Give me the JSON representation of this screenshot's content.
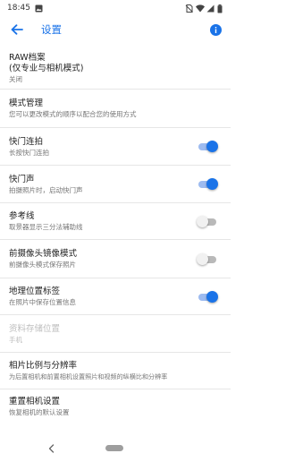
{
  "status_bar": {
    "time": "18:45",
    "icons": [
      "image-icon",
      "no-sim-icon",
      "wifi-icon",
      "signal-icon",
      "battery-icon"
    ]
  },
  "app_bar": {
    "title": "设置",
    "back_icon": "arrow-back-icon",
    "info_icon": "info-icon"
  },
  "settings": {
    "raw": {
      "title": "RAW档案",
      "title_line2": "(仅专业与相机模式)",
      "subtitle": "关闭"
    },
    "mode_management": {
      "title": "模式管理",
      "subtitle": "您可以更改模式的顺序以配合您的使用方式"
    },
    "burst": {
      "title": "快门连拍",
      "subtitle": "长按快门连拍",
      "enabled": true
    },
    "shutter_sound": {
      "title": "快门声",
      "subtitle": "拍摄照片时，启动快门声",
      "enabled": true
    },
    "grid": {
      "title": "参考线",
      "subtitle": "取景器显示三分法辅助线",
      "enabled": false
    },
    "front_mirror": {
      "title": "前摄像头镜像模式",
      "subtitle": "前摄像头模式保存照片",
      "enabled": false
    },
    "geo_tag": {
      "title": "地理位置标签",
      "subtitle": "在照片中保存位置信息",
      "enabled": true
    },
    "storage": {
      "title": "资料存储位置",
      "subtitle": "手机",
      "disabled": true
    },
    "aspect_ratio": {
      "title": "相片比例与分辨率",
      "subtitle": "为后置相机和前置相机设置照片和视频的纵横比和分辨率"
    },
    "reset": {
      "title": "重置相机设置",
      "subtitle": "恢复相机的默认设置"
    }
  },
  "colors": {
    "accent": "#1a73e8",
    "toggle_track_on": "#9dbbf0",
    "toggle_off": "#b9b9b9",
    "divider": "#e6e6e6",
    "text_primary": "#212121",
    "text_secondary": "#757575",
    "text_disabled": "#bdbdbd"
  }
}
